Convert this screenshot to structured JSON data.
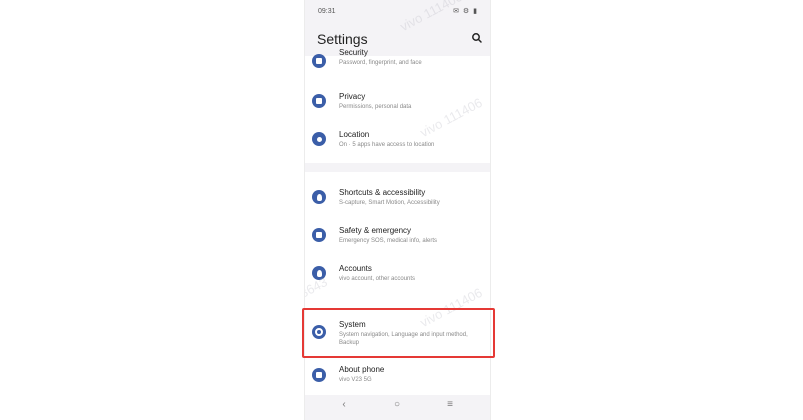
{
  "statusbar": {
    "time": "09:31",
    "icons": "✉ ⚙ ▮"
  },
  "header": {
    "title": "Settings"
  },
  "watermarks": [
    "vivo 111406",
    "vivo 111406",
    "3643",
    "vivo 111406"
  ],
  "groups": [
    [
      {
        "name": "security",
        "label": "Security",
        "sub": "Password, fingerprint, and face"
      },
      {
        "name": "privacy",
        "label": "Privacy",
        "sub": "Permissions, personal data"
      },
      {
        "name": "location",
        "label": "Location",
        "sub": "On · 5 apps have access to location"
      }
    ],
    [
      {
        "name": "shortcuts-accessibility",
        "label": "Shortcuts & accessibility",
        "sub": "S-capture, Smart Motion, Accessibility"
      },
      {
        "name": "safety-emergency",
        "label": "Safety & emergency",
        "sub": "Emergency SOS, medical info, alerts"
      },
      {
        "name": "accounts",
        "label": "Accounts",
        "sub": "vivo account, other accounts"
      },
      {
        "name": "system",
        "label": "System",
        "sub": "System navigation, Language and input method, Backup"
      },
      {
        "name": "about-phone",
        "label": "About phone",
        "sub": "vivo V23 5G"
      }
    ]
  ],
  "icons": {
    "search": "search-icon",
    "back": "‹",
    "home": "○",
    "recents": "≡"
  },
  "colors": {
    "accent": "#3b5ea8",
    "highlight": "#e53935"
  }
}
